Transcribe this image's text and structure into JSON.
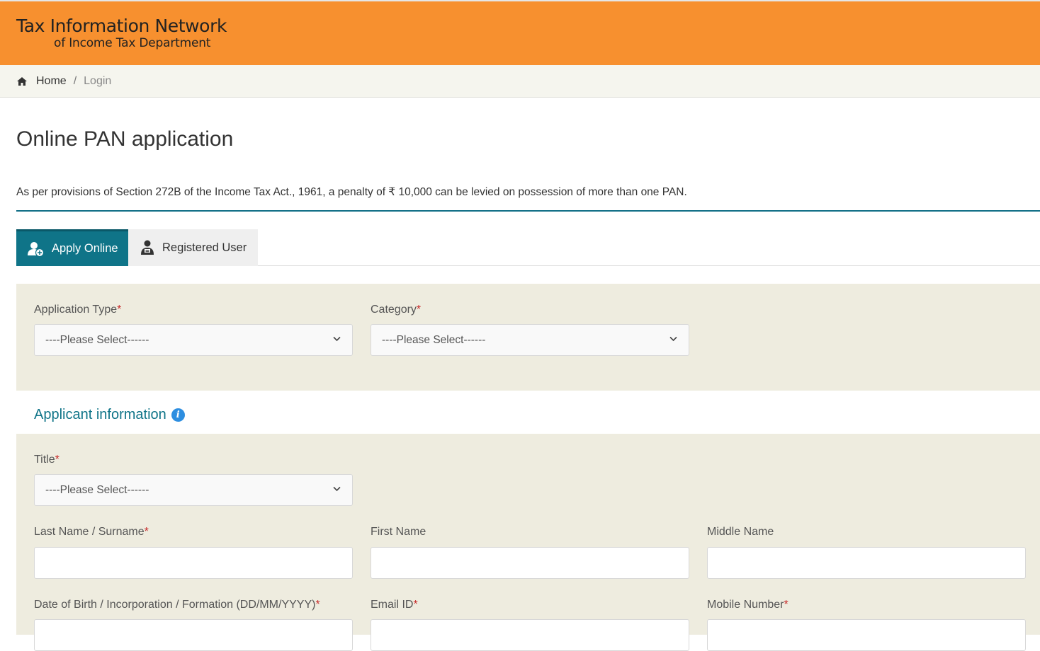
{
  "header": {
    "brand_line1": "Tax Information Network",
    "brand_line2": "of Income Tax Department",
    "color": "#f7902f"
  },
  "breadcrumb": {
    "home": "Home",
    "separator": "/",
    "current": "Login"
  },
  "page": {
    "title": "Online PAN application",
    "notice": "As per provisions of Section 272B of the Income Tax Act., 1961, a penalty of ₹ 10,000 can be levied on possession of more than one PAN."
  },
  "tabs": [
    {
      "label": "Apply Online",
      "active": true,
      "icon": "user-plus-icon"
    },
    {
      "label": "Registered User",
      "active": false,
      "icon": "registered-user-icon"
    }
  ],
  "form": {
    "application_type": {
      "label": "Application Type",
      "required": "*",
      "value": "----Please Select------"
    },
    "category": {
      "label": "Category",
      "required": "*",
      "value": "----Please Select------"
    },
    "applicant_section_title": "Applicant information",
    "title_field": {
      "label": "Title",
      "required": "*",
      "value": "----Please Select------"
    },
    "last_name": {
      "label": "Last Name / Surname",
      "required": "*",
      "value": ""
    },
    "first_name": {
      "label": "First Name",
      "value": ""
    },
    "middle_name": {
      "label": "Middle Name",
      "value": ""
    },
    "dob": {
      "label": "Date of Birth / Incorporation / Formation (DD/MM/YYYY)",
      "required": "*",
      "value": ""
    },
    "email": {
      "label": "Email ID",
      "required": "*",
      "value": ""
    },
    "mobile": {
      "label": "Mobile Number",
      "required": "*",
      "value": ""
    }
  },
  "colors": {
    "accent": "#0f7488",
    "panel": "#eeecdf",
    "required": "#c62828",
    "info": "#2d8ee0"
  }
}
